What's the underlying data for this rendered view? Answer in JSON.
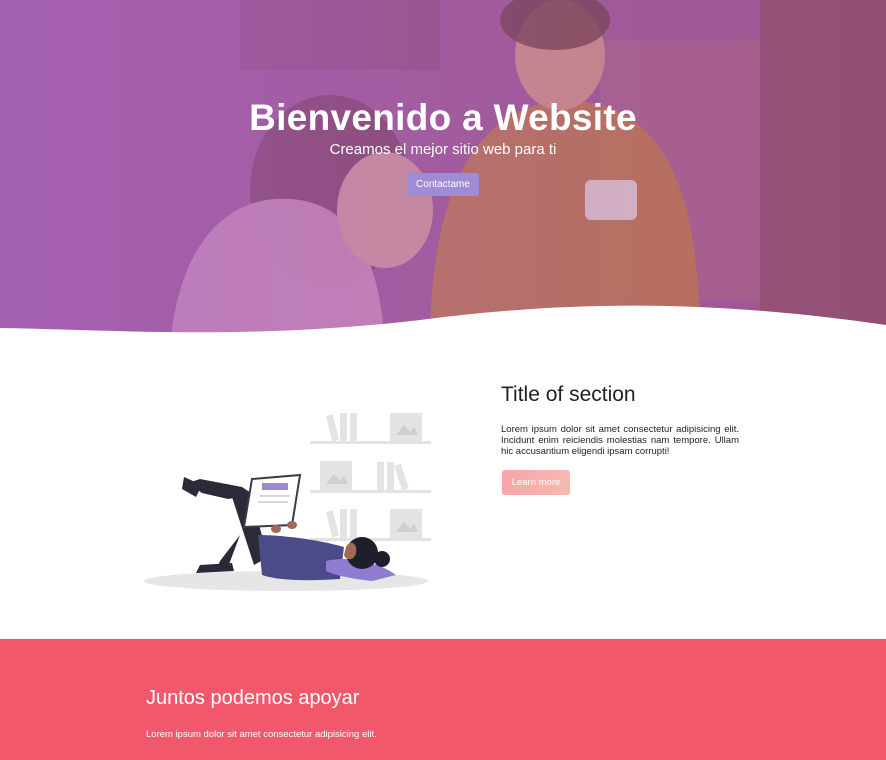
{
  "hero": {
    "title": "Bienvenido a Website",
    "subtitle": "Creamos el mejor sitio web para ti",
    "button_label": "Contactame"
  },
  "section": {
    "title": "Title of section",
    "text": "Lorem ipsum dolor sit amet consectetur adipisicing elit. Incidunt enim reiciendis molestias nam tempore. Ullam hic accusantium eligendi ipsam corrupti!",
    "button_label": "Learn more"
  },
  "band": {
    "title": "Juntos podemos apoyar",
    "text": "Lorem ipsum dolor sit amet consectetur adipisicing elit."
  },
  "colors": {
    "hero_purple": "#9f5bab",
    "contact_button": "#9f8bd6",
    "learn_button": "#f7a6a6",
    "band": "#f2586c"
  }
}
